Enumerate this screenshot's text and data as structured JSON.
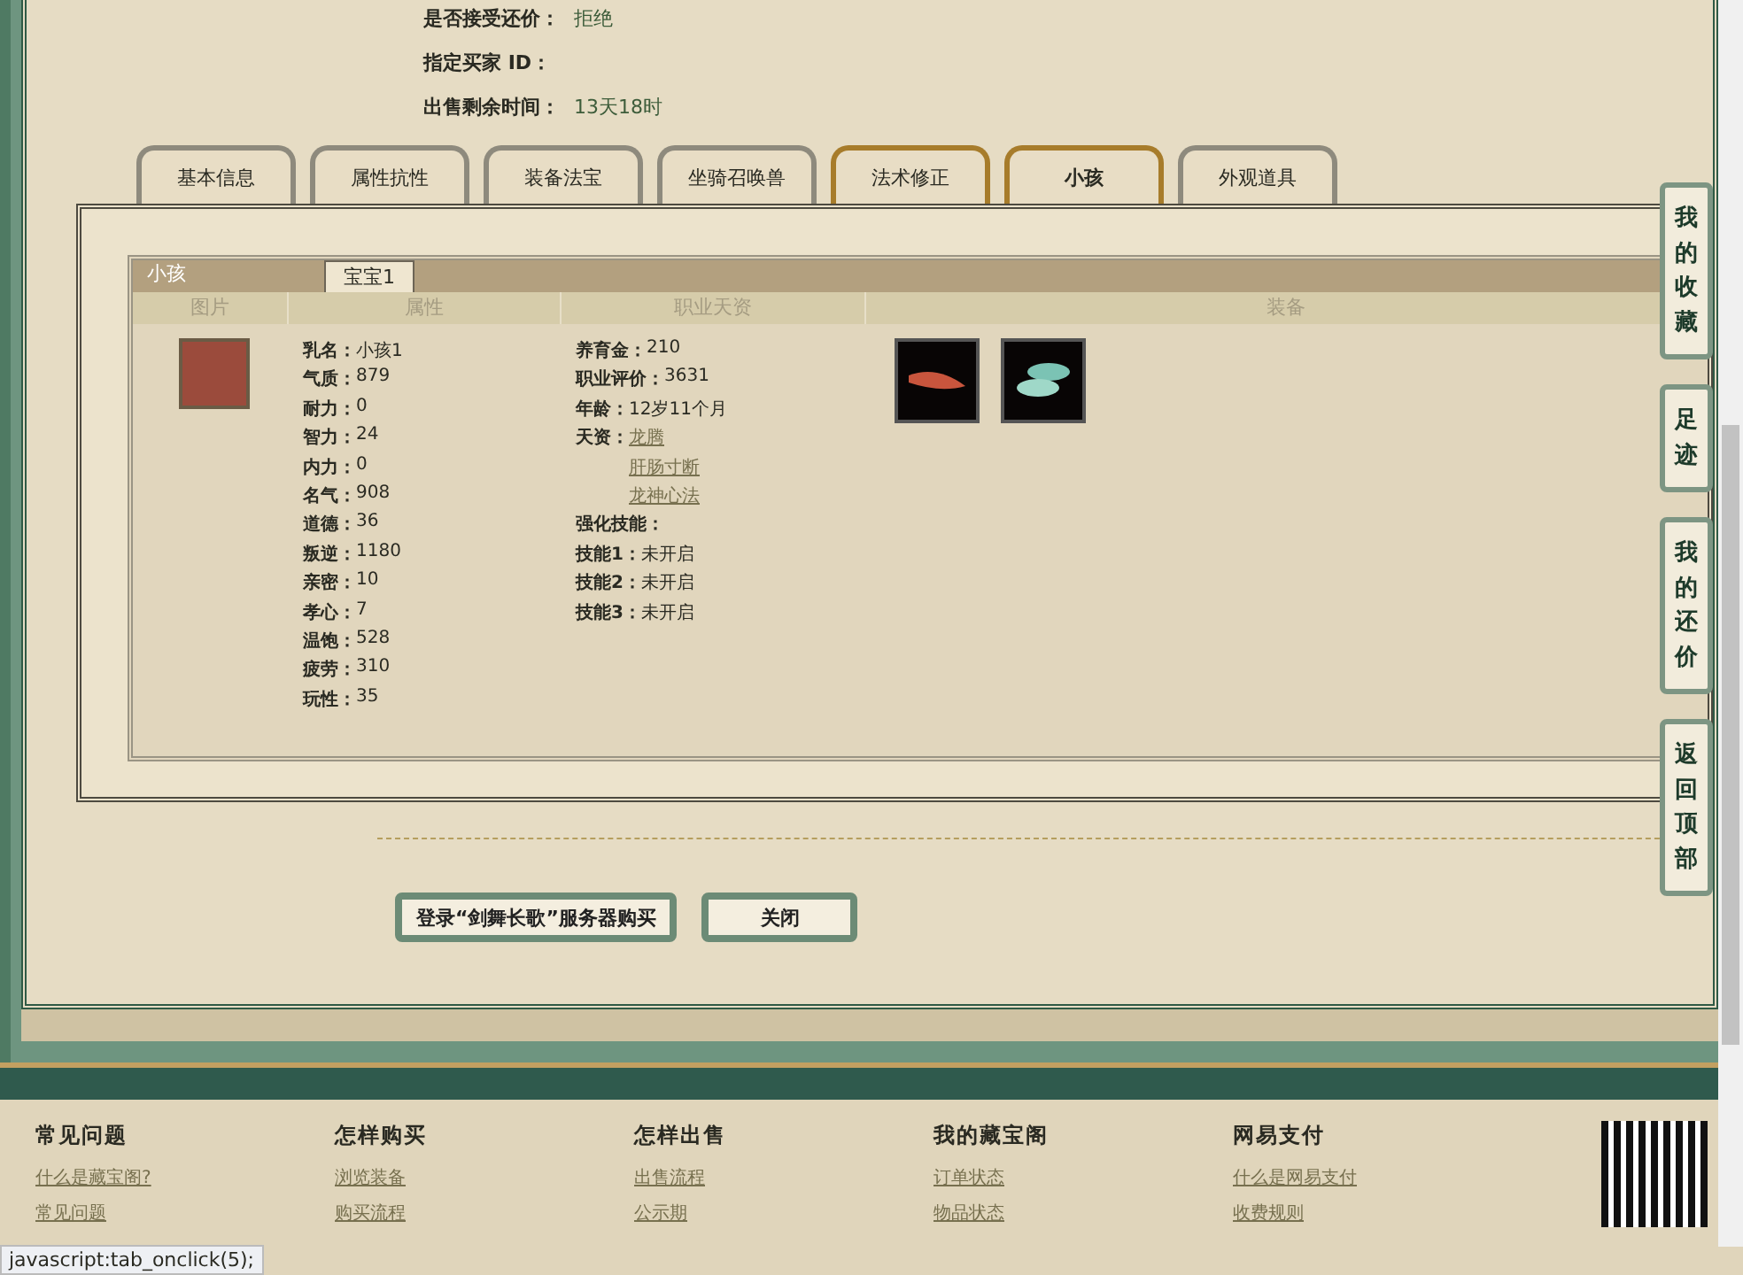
{
  "sale_info": [
    {
      "label": "是否接受还价：",
      "value": "拒绝"
    },
    {
      "label": "指定买家 ID："
    },
    {
      "label": "出售剩余时间：",
      "value": "13天18时"
    }
  ],
  "tabs": [
    {
      "label": "基本信息",
      "selected": false,
      "hovered": false
    },
    {
      "label": "属性抗性",
      "selected": false,
      "hovered": false
    },
    {
      "label": "装备法宝",
      "selected": false,
      "hovered": false
    },
    {
      "label": "坐骑召唤兽",
      "selected": false,
      "hovered": false
    },
    {
      "label": "法术修正",
      "selected": false,
      "hovered": true
    },
    {
      "label": "小孩",
      "selected": true,
      "hovered": false
    },
    {
      "label": "外观道具",
      "selected": false,
      "hovered": false
    }
  ],
  "child_panel": {
    "title": "小孩",
    "subtabs": [
      {
        "label": "宝宝1",
        "selected": true
      }
    ],
    "columns": [
      "图片",
      "属性",
      "职业天资",
      "装备"
    ],
    "attributes": [
      {
        "label": "乳名：",
        "value": "小孩1"
      },
      {
        "label": "气质：",
        "value": "879"
      },
      {
        "label": "耐力：",
        "value": "0"
      },
      {
        "label": "智力：",
        "value": "24"
      },
      {
        "label": "内力：",
        "value": "0"
      },
      {
        "label": "名气：",
        "value": "908"
      },
      {
        "label": "道德：",
        "value": "36"
      },
      {
        "label": "叛逆：",
        "value": "1180"
      },
      {
        "label": "亲密：",
        "value": "10"
      },
      {
        "label": "孝心：",
        "value": "7"
      },
      {
        "label": "温饱：",
        "value": "528"
      },
      {
        "label": "疲劳：",
        "value": "310"
      },
      {
        "label": "玩性：",
        "value": "35"
      }
    ],
    "career": [
      {
        "kind": "pair",
        "label": "养育金：",
        "value": "210"
      },
      {
        "kind": "pair",
        "label": "职业评价：",
        "value": "3631"
      },
      {
        "kind": "pair",
        "label": "年龄：",
        "value": "12岁11个月"
      },
      {
        "kind": "links",
        "label": "天资：",
        "links": [
          "龙腾",
          "肝肠寸断",
          "龙神心法"
        ]
      },
      {
        "kind": "heading",
        "label": "强化技能："
      },
      {
        "kind": "pair",
        "label": "技能1：",
        "value": "未开启"
      },
      {
        "kind": "pair",
        "label": "技能2：",
        "value": "未开启"
      },
      {
        "kind": "pair",
        "label": "技能3：",
        "value": "未开启"
      }
    ],
    "equipment": [
      {
        "kind": "feather"
      },
      {
        "kind": "shoes"
      }
    ]
  },
  "buttons": [
    "登录“剑舞长歌”服务器购买",
    "关闭"
  ],
  "side_buttons": [
    "我的收藏",
    "足迹",
    "我的还价",
    "返回顶部"
  ],
  "footer": [
    {
      "heading": "常见问题",
      "links": [
        "什么是藏宝阁?",
        "常见问题"
      ]
    },
    {
      "heading": "怎样购买",
      "links": [
        "浏览装备",
        "购买流程"
      ]
    },
    {
      "heading": "怎样出售",
      "links": [
        "出售流程",
        "公示期"
      ]
    },
    {
      "heading": "我的藏宝阁",
      "links": [
        "订单状态",
        "物品状态"
      ]
    },
    {
      "heading": "网易支付",
      "links": [
        "什么是网易支付",
        "收费规则"
      ]
    }
  ],
  "status_bar": "javascript:tab_onclick(5);"
}
